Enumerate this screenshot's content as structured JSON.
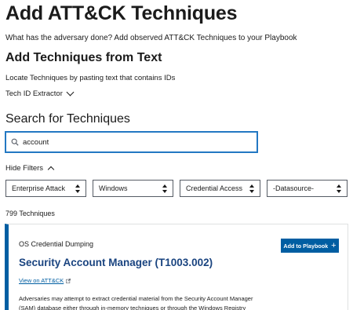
{
  "header": {
    "title": "Add ATT&CK Techniques",
    "subtitle": "What has the adversary done? Add observed ATT&CK Techniques to your Playbook"
  },
  "from_text": {
    "heading": "Add Techniques from Text",
    "description": "Locate Techniques by pasting text that contains IDs",
    "extractor_label": "Tech ID Extractor"
  },
  "search": {
    "heading": "Search for Techniques",
    "value": "account",
    "icon": "search-icon"
  },
  "filters": {
    "toggle_label": "Hide Filters",
    "selects": [
      {
        "value": "Enterprise Attack"
      },
      {
        "value": "Windows"
      },
      {
        "value": "Credential Access"
      },
      {
        "value": "-Datasource-"
      }
    ]
  },
  "results": {
    "count_label": "799 Techniques"
  },
  "card": {
    "tactic": "OS Credential Dumping",
    "add_button_label": "Add to Playbook",
    "title": "Security Account Manager (T1003.002)",
    "view_link": "View on ATT&CK",
    "description": "Adversaries may attempt to extract credential material from the Security Account Manager (SAM) database either through in-memory techniques or through the Windows Registry"
  },
  "colors": {
    "accent": "#005ea2",
    "focus_border": "#2378c3",
    "title_color": "#1a4480"
  }
}
